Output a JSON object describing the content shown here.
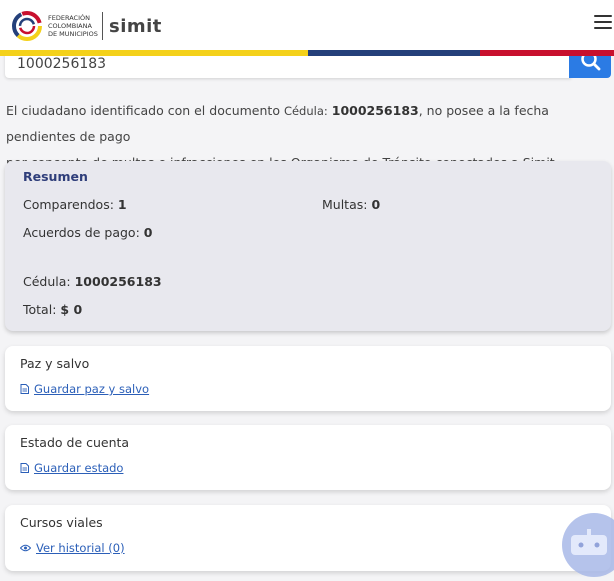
{
  "header": {
    "logo_lines": [
      "FEDERACIÓN",
      "COLOMBIANA",
      "DE MUNICIPIOS"
    ],
    "brand": "simit"
  },
  "search": {
    "value": "1000256183"
  },
  "info": {
    "part1": "El ciudadano identificado con el documento",
    "doc_type": "Cédula:",
    "doc_number": "1000256183",
    "part2": ", no posee a la fecha pendientes de pago",
    "line2": "por concepto de multas e infracciones en los Organismo de Tránsito conectados a Simit."
  },
  "resumen": {
    "title": "Resumen",
    "comparendos_label": "Comparendos:",
    "comparendos_value": "1",
    "multas_label": "Multas:",
    "multas_value": "0",
    "acuerdos_label": "Acuerdos de pago:",
    "acuerdos_value": "0",
    "cedula_label": "Cédula:",
    "cedula_value": "1000256183",
    "total_label": "Total:",
    "total_value": "$ 0"
  },
  "cards": [
    {
      "title": "Paz y salvo",
      "link": "Guardar paz y salvo",
      "icon": "document-icon"
    },
    {
      "title": "Estado de cuenta",
      "link": "Guardar estado",
      "icon": "document-icon"
    },
    {
      "title": "Cursos viales",
      "link": "Ver historial (0)",
      "icon": "eye-icon"
    }
  ],
  "colors": {
    "flag_yellow": "#f4d11a",
    "flag_blue": "#24407a",
    "flag_red": "#c8102e",
    "accent": "#2b7be4",
    "link": "#2b5fb8"
  }
}
